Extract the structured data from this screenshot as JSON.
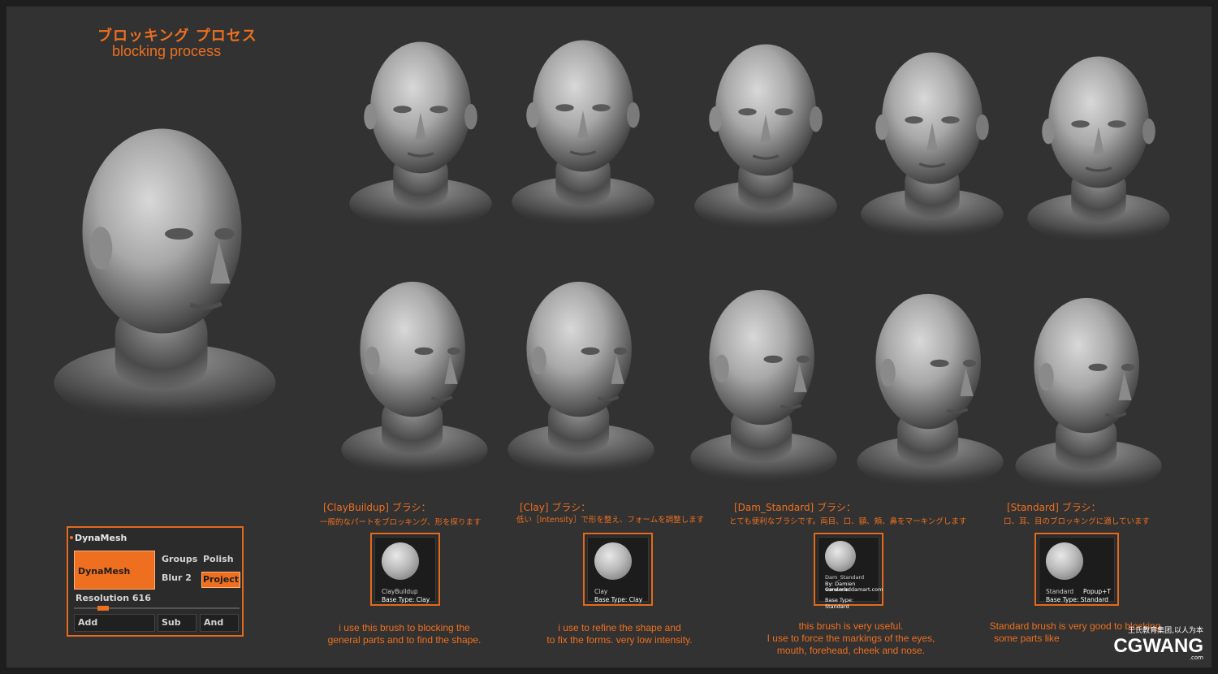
{
  "title": {
    "jp": "ブロッキング プロセス",
    "en": "blocking process"
  },
  "palette": {
    "accent": "#ee6f1f",
    "background": "#323232"
  },
  "brushes": [
    {
      "title": "[ClayBuildup] ブラシ：",
      "jp": "一般的なパートをブロッキング、形を探ります",
      "icon": {
        "name": "ClayBuildup",
        "type": "Base Type: Clay"
      },
      "desc": [
        "i use this brush to blocking the",
        "general parts and to find the shape."
      ]
    },
    {
      "title": "[Clay] ブラシ：",
      "jp": "低い［Intensity］で形を整え、フォームを調整します",
      "icon": {
        "name": "Clay",
        "type": "Base Type: Clay"
      },
      "desc": [
        "i use to refine the shape and",
        "to fix the forms.  very low intensity."
      ]
    },
    {
      "title": "[Dam_Standard] ブラシ：",
      "jp": "とても便利なブラシです。両目、口、額、頬、鼻をマーキングします",
      "icon": {
        "name": "Dam_Standard",
        "author": "By: Damien Canderle",
        "site": "www.maddamart.com",
        "type": "Base Type: Standard"
      },
      "desc": [
        "this brush is very useful.",
        "I use to force the markings of the eyes,",
        "mouth, forehead, cheek and nose."
      ]
    },
    {
      "title": "[Standard] ブラシ：",
      "jp": "口、耳、目のブロッキングに適しています",
      "icon": {
        "name": "Standard",
        "popup": "Popup+T",
        "type": "Base Type: Standard"
      },
      "desc": [
        "Standard brush is very good to blocking",
        "some parts like"
      ]
    }
  ],
  "dynamesh": {
    "header": "DynaMesh",
    "main_button": "DynaMesh",
    "groups": "Groups",
    "polish": "Polish",
    "blur": "Blur 2",
    "project": "Project",
    "resolution": "Resolution 616",
    "add": "Add",
    "sub": "Sub",
    "and": "And"
  },
  "watermark": {
    "top": "王氏教育集团,以人为本",
    "main": "CGWANG",
    "suffix": ".com"
  }
}
